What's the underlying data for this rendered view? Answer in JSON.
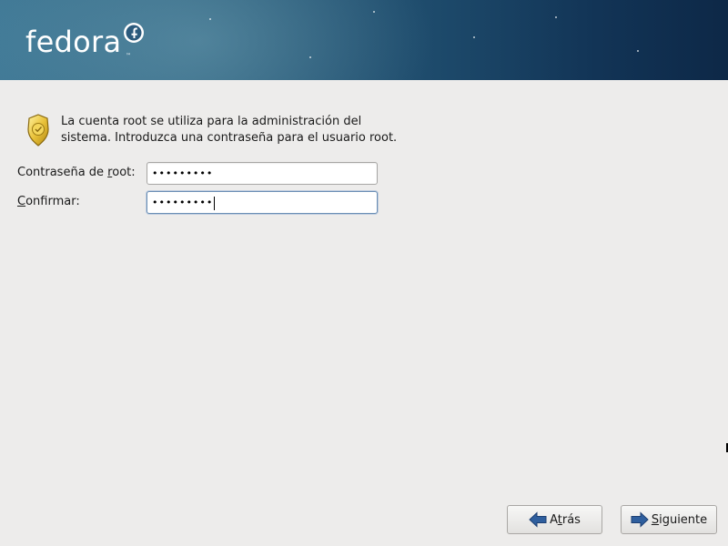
{
  "header": {
    "logo_text": "fedora",
    "logo_tm": "™",
    "logo_icon": "fedora-infinity-f-icon"
  },
  "intro": {
    "icon": "security-shield-icon",
    "line1": "La cuenta root se utiliza para la administración del",
    "line2": "sistema. Introduzca una contraseña para el usuario root."
  },
  "form": {
    "root_password": {
      "label_pre": "Contraseña de ",
      "label_mnemonic": "r",
      "label_post": "oot:",
      "value_mask": "•••••••••"
    },
    "confirm": {
      "label_pre": "",
      "label_mnemonic": "C",
      "label_post": "onfirmar:",
      "value_mask": "•••••••••"
    }
  },
  "buttons": {
    "back": {
      "pre": "A",
      "mnemonic": "t",
      "post": "rás",
      "icon": "arrow-left-icon"
    },
    "next": {
      "pre": "",
      "mnemonic": "S",
      "post": "iguiente",
      "icon": "arrow-right-icon"
    }
  },
  "colors": {
    "banner_left": "#3f7895",
    "banner_right": "#0d2847",
    "background": "#edeceb",
    "arrow_blue": "#2f5f9e"
  }
}
